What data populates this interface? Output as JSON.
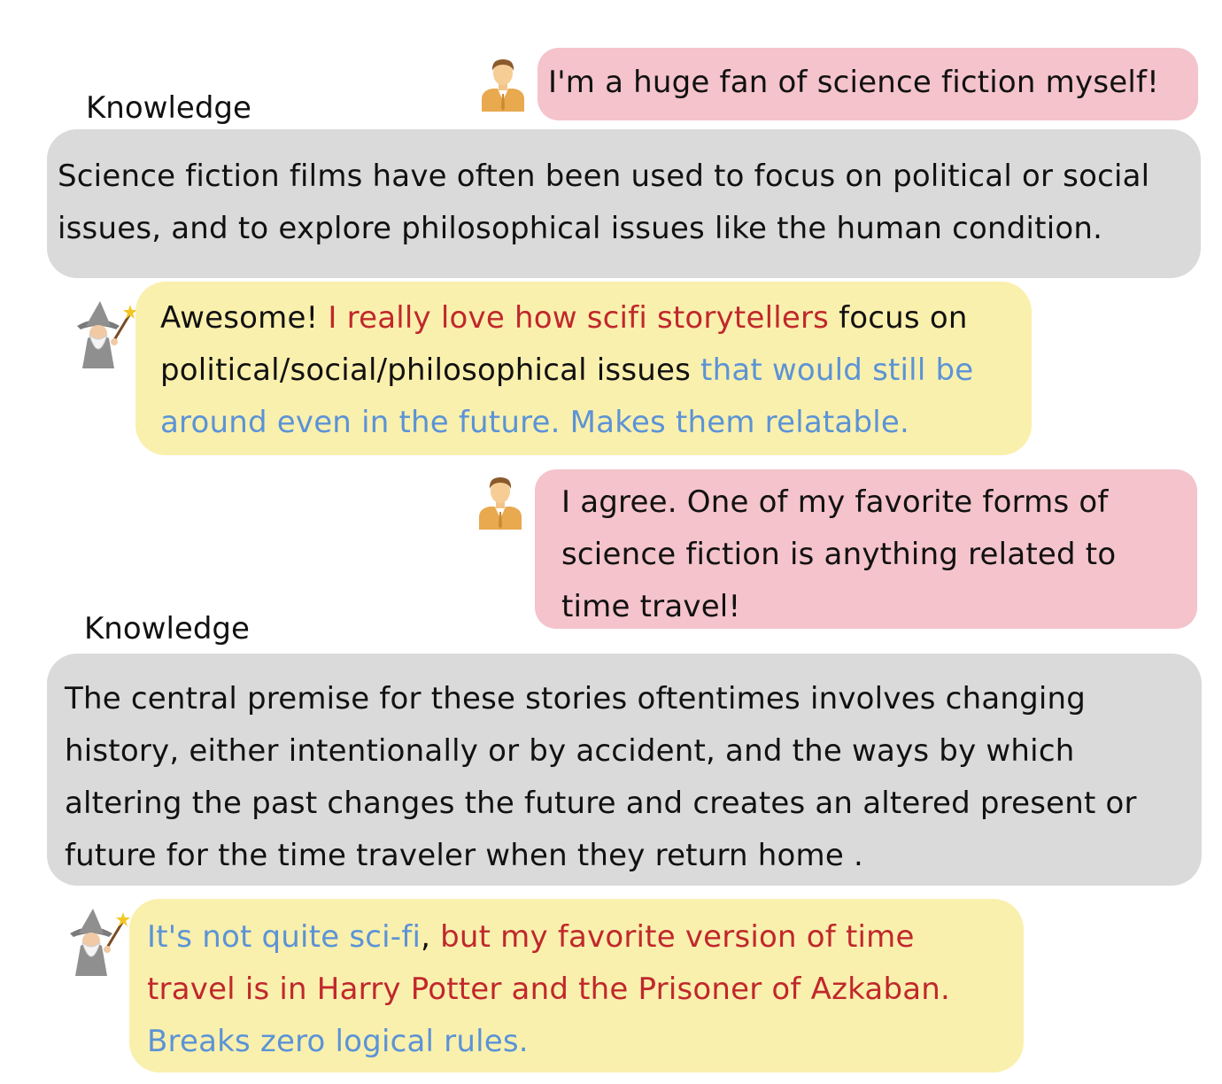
{
  "colors": {
    "user_bubble": "#f4c3cb",
    "knowledge_bubble": "#dadada",
    "wizard_bubble": "#faf0ad",
    "highlight_red": "#c0282c",
    "highlight_blue": "#5b93d6"
  },
  "icons": {
    "user": "person-avatar-icon",
    "wizard": "wizard-avatar-icon"
  },
  "turns": [
    {
      "speaker": "user",
      "text": "I'm a huge fan of science fiction myself!"
    },
    {
      "speaker": "knowledge",
      "label": "Knowledge",
      "text": "Science fiction films have often been used to focus on political or social issues, and to explore philosophical issues like the human condition."
    },
    {
      "speaker": "wizard",
      "segments": [
        {
          "text": "Awesome! ",
          "style": "plain"
        },
        {
          "text": "I really love how scifi storytellers",
          "style": "red"
        },
        {
          "text": " focus on political/social/philosophical issues ",
          "style": "plain"
        },
        {
          "text": "that would still be around even in the future. Makes them relatable.",
          "style": "blue"
        }
      ]
    },
    {
      "speaker": "user",
      "text": "I agree. One of my favorite forms of science fiction is anything related to time travel!"
    },
    {
      "speaker": "knowledge",
      "label": "Knowledge",
      "text": "The central premise for these stories oftentimes involves changing history, either intentionally or by accident, and the ways by which altering the past changes the future and creates an altered present or future for the time traveler when they return home ."
    },
    {
      "speaker": "wizard",
      "segments": [
        {
          "text": "It's not quite sci-fi",
          "style": "blue"
        },
        {
          "text": ", ",
          "style": "plain"
        },
        {
          "text": "but my favorite version of time travel is in Harry Potter and the Prisoner of Azkaban.",
          "style": "red"
        },
        {
          "text": " ",
          "style": "plain"
        },
        {
          "text": "Breaks zero logical rules.",
          "style": "blue"
        }
      ]
    }
  ]
}
